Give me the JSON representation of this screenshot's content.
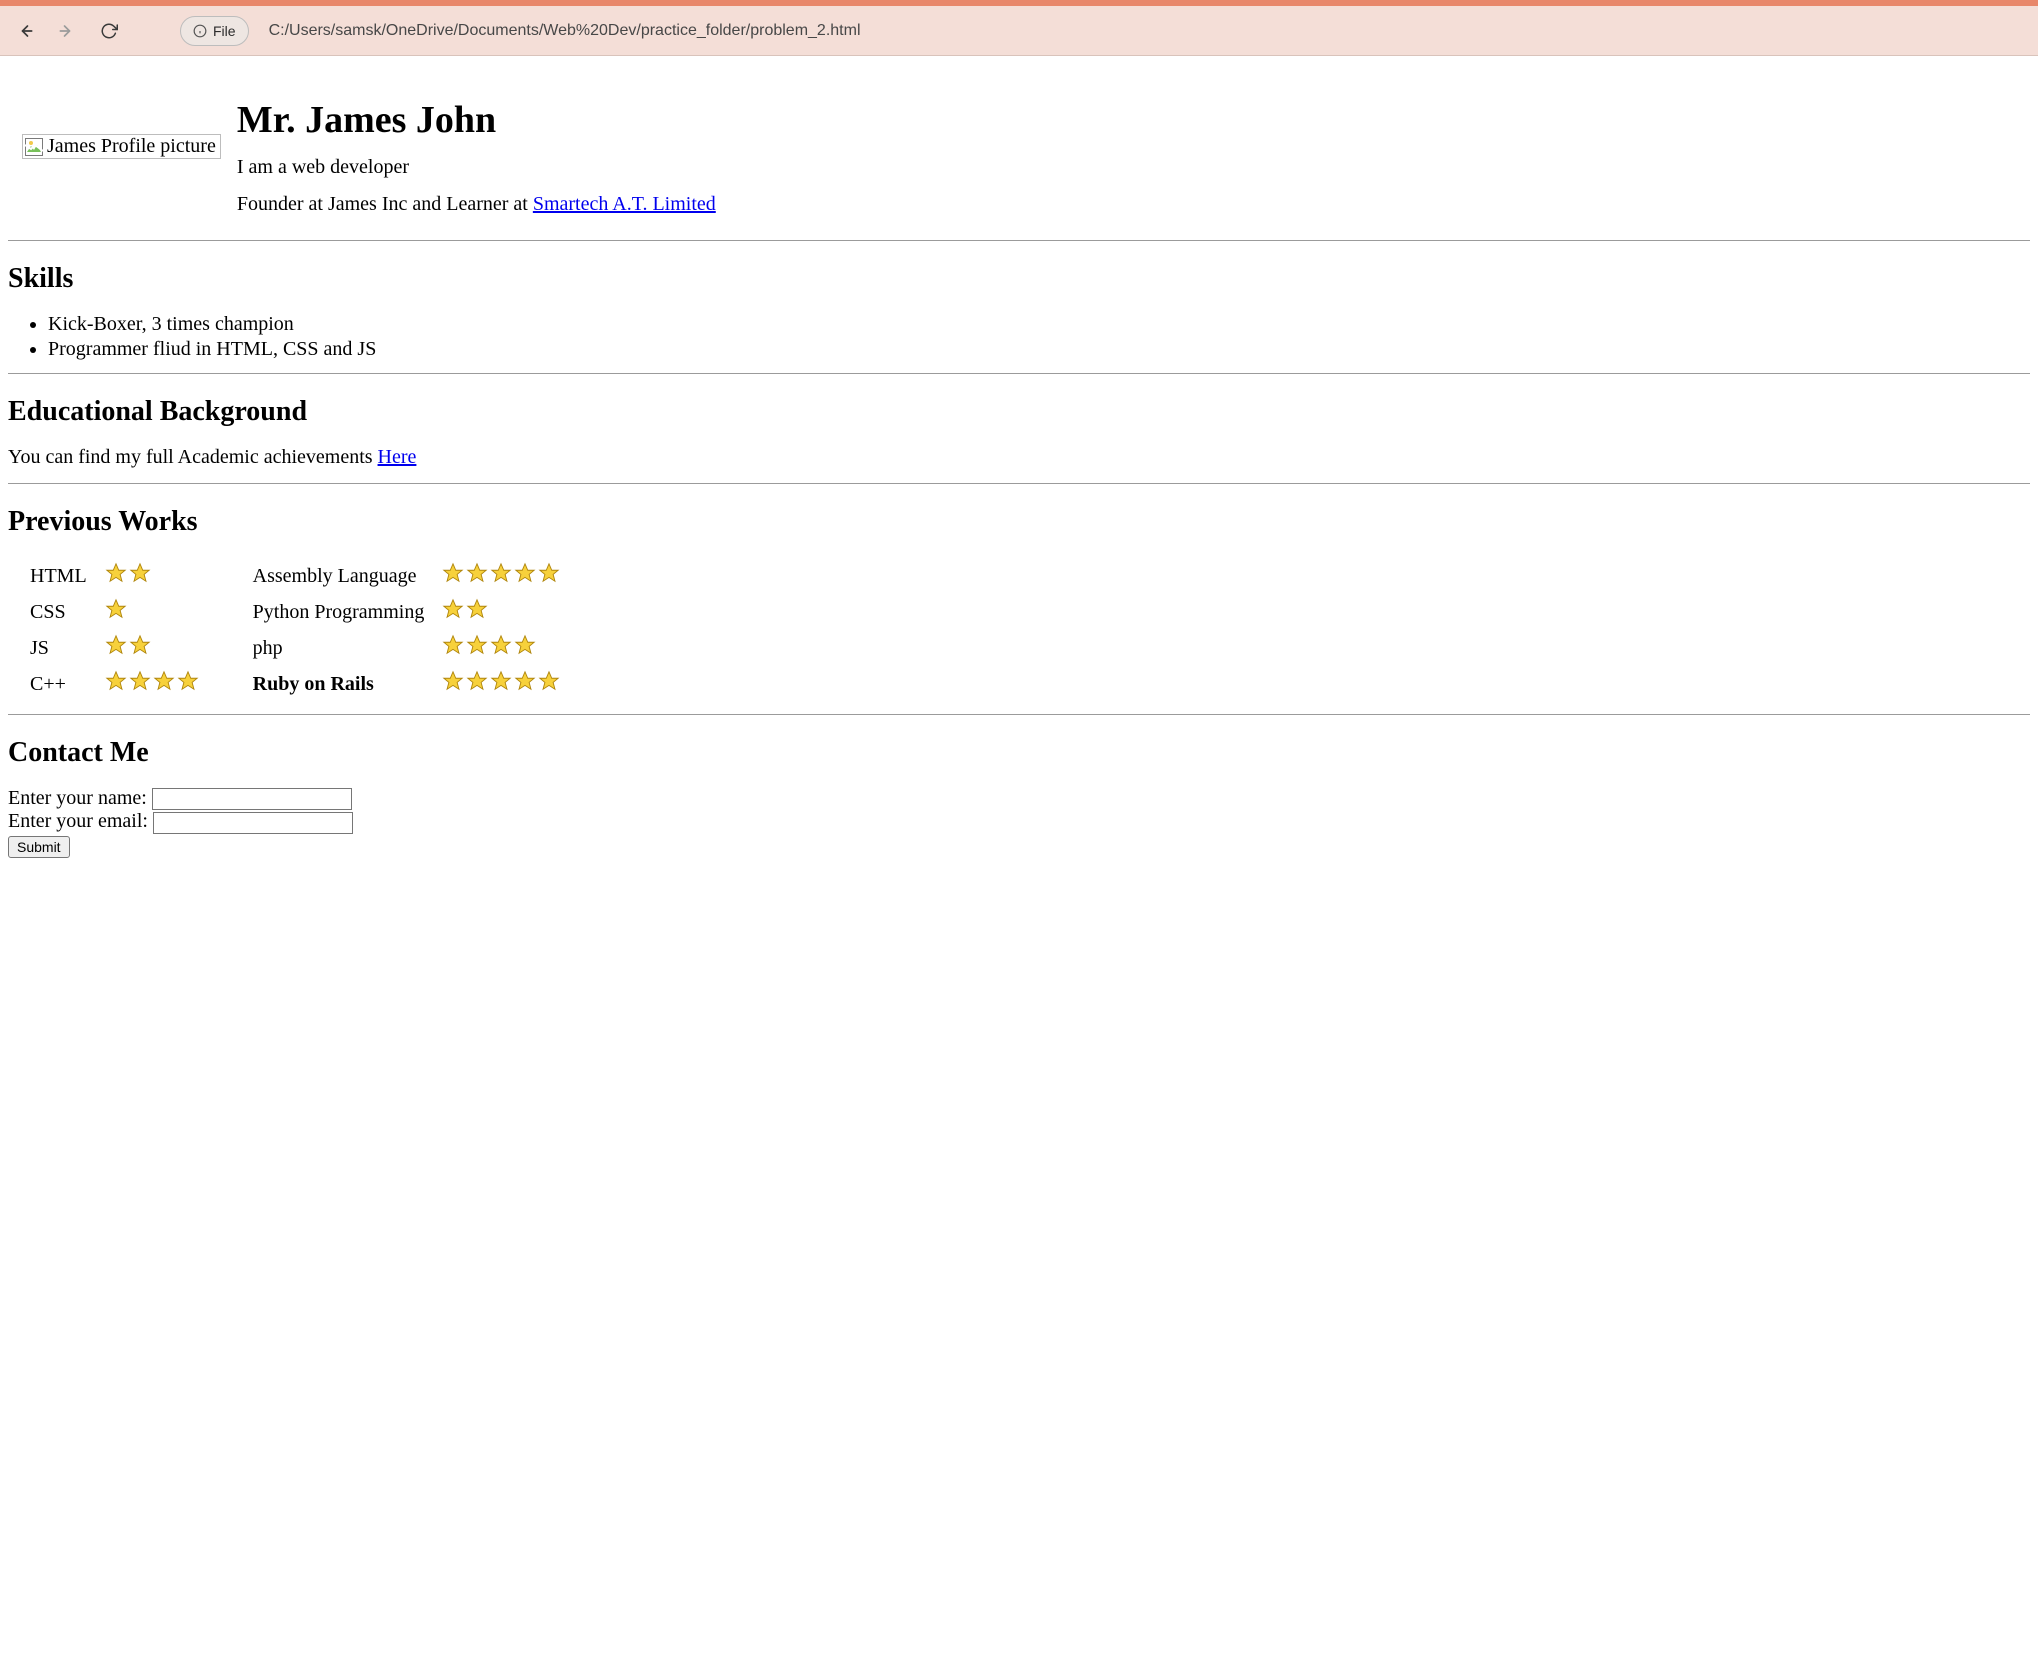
{
  "browser": {
    "scheme_label": "File",
    "url": "C:/Users/samsk/OneDrive/Documents/Web%20Dev/practice_folder/problem_2.html"
  },
  "profile": {
    "alt_text": "James Profile picture",
    "name": "Mr. James John",
    "tagline": "I am a web developer",
    "founder_prefix": "Founder at James Inc and Learner at ",
    "company_link": "Smartech A.T. Limited"
  },
  "skills": {
    "heading": "Skills",
    "items": [
      "Kick-Boxer, 3 times champion",
      "Programmer fliud in HTML, CSS and JS"
    ]
  },
  "education": {
    "heading": "Educational Background",
    "text": "You can find my full Academic achievements ",
    "link": "Here"
  },
  "works": {
    "heading": "Previous Works",
    "left": [
      {
        "label": "HTML",
        "stars": 2,
        "bold": false
      },
      {
        "label": "CSS",
        "stars": 1,
        "bold": false
      },
      {
        "label": "JS",
        "stars": 2,
        "bold": false
      },
      {
        "label": "C++",
        "stars": 4,
        "bold": false
      }
    ],
    "right": [
      {
        "label": "Assembly Language",
        "stars": 5,
        "bold": false
      },
      {
        "label": "Python Programming",
        "stars": 2,
        "bold": false
      },
      {
        "label": "php",
        "stars": 4,
        "bold": false
      },
      {
        "label": "Ruby on Rails",
        "stars": 5,
        "bold": true
      }
    ]
  },
  "contact": {
    "heading": "Contact Me",
    "name_label": "Enter your name:",
    "email_label": "Enter your email:",
    "submit_label": "Submit"
  }
}
